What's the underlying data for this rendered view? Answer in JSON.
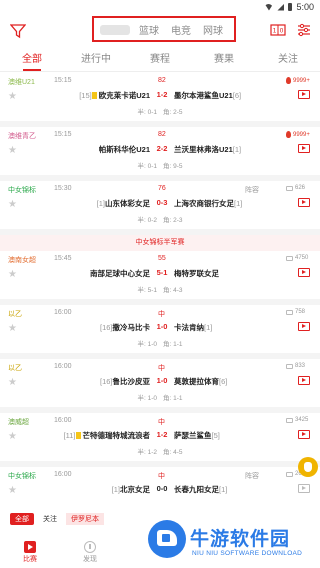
{
  "status": {
    "time": "5:00"
  },
  "sport_tabs": [
    "篮球",
    "电竞",
    "网球"
  ],
  "subtabs": [
    "全部",
    "进行中",
    "赛程",
    "赛果",
    "关注"
  ],
  "matches": [
    {
      "league": "澳维U21",
      "league_color": "#8bb94a",
      "time": "15:15",
      "status": "82",
      "extra": "",
      "hot": "9999+",
      "hot_red": true,
      "home_rank": "[15]",
      "home": "欧克莱卡诺U21",
      "home_card": true,
      "score": "1-2",
      "score_red": true,
      "away": "墨尔本港鲨鱼U21",
      "away_rank": "[6]",
      "video_red": true,
      "half_label": "半: 0-1",
      "half_value": "角: 2-5"
    },
    {
      "league": "澳维青乙",
      "league_color": "#d25a8c",
      "time": "15:15",
      "status": "82",
      "extra": "",
      "hot": "9999+",
      "hot_red": true,
      "home_rank": "",
      "home": "帕斯科华伦U21",
      "home_card": false,
      "score": "2-2",
      "score_red": true,
      "away": "兰沃里林弗洛U21",
      "away_rank": "[1]",
      "video_red": true,
      "half_label": "半: 0-1",
      "half_value": "角: 9-5"
    },
    {
      "league": "中女锦标",
      "league_color": "#2aa84a",
      "time": "15:30",
      "status": "76",
      "extra": "阵容",
      "hot": "626",
      "hot_red": false,
      "home_rank": "[1]",
      "home": "山东体彩女足",
      "home_card": false,
      "score": "0-3",
      "score_red": true,
      "away": "上海农商银行女足",
      "away_rank": "[1]",
      "video_red": true,
      "half_label": "半: 0-2",
      "half_value": "角: 2-3"
    },
    {
      "banner": "中女锦标半军赛"
    },
    {
      "league": "澳南女超",
      "league_color": "#e26a2c",
      "time": "15:45",
      "status": "55",
      "extra": "",
      "hot": "4750",
      "hot_red": false,
      "home_rank": "",
      "home": "南部足球中心女足",
      "home_card": false,
      "score": "5-1",
      "score_red": true,
      "away": "梅特罗联女足",
      "away_rank": "",
      "video_red": true,
      "half_label": "半: 5-1",
      "half_value": "角: 4-3"
    },
    {
      "league": "以乙",
      "league_color": "#c8a200",
      "time": "16:00",
      "status": "中",
      "extra": "",
      "hot": "758",
      "hot_red": false,
      "home_rank": "[16]",
      "home": "撒冷马比卡",
      "home_card": false,
      "score": "1-0",
      "score_red": true,
      "away": "卡法肯纳",
      "away_rank": "[1]",
      "video_red": true,
      "half_label": "半: 1-0",
      "half_value": "角: 1-1"
    },
    {
      "league": "以乙",
      "league_color": "#c8a200",
      "time": "16:00",
      "status": "中",
      "extra": "",
      "hot": "833",
      "hot_red": false,
      "home_rank": "[16]",
      "home": "鲁比沙皮亚",
      "home_card": false,
      "score": "1-0",
      "score_red": true,
      "away": "莫敦提拉体育",
      "away_rank": "[6]",
      "video_red": true,
      "half_label": "半: 1-0",
      "half_value": "角: 1-1"
    },
    {
      "league": "澳威超",
      "league_color": "#6aa63e",
      "time": "16:00",
      "status": "中",
      "extra": "",
      "hot": "3425",
      "hot_red": false,
      "home_rank": "[11]",
      "home": "芒特德瑞特城流浪者",
      "home_card": true,
      "score": "1-2",
      "score_red": true,
      "away": "萨瑟兰鲨鱼",
      "away_rank": "[5]",
      "video_red": true,
      "half_label": "半: 1-2",
      "half_value": "角: 4-5"
    },
    {
      "league": "中女锦标",
      "league_color": "#2aa84a",
      "time": "16:00",
      "status": "中",
      "extra": "阵容",
      "hot": "262",
      "hot_red": false,
      "home_rank": "[1]",
      "home": "北京女足",
      "home_card": false,
      "score": "0-0",
      "score_red": false,
      "away": "长春九阳女足",
      "away_rank": "[1]",
      "video_red": false,
      "half_label": "",
      "half_value": ""
    }
  ],
  "bottom_strip": {
    "all": "全部",
    "follow": "关注",
    "league": "伊罗尼本"
  },
  "tabbar": [
    {
      "label": "比赛",
      "icon": "match-play-icon"
    },
    {
      "label": "发现",
      "icon": "discover-icon"
    }
  ],
  "watermark": {
    "title": "牛游软件园",
    "subtitle": "NIU NIU SOFTWARE DOWNLOAD"
  }
}
